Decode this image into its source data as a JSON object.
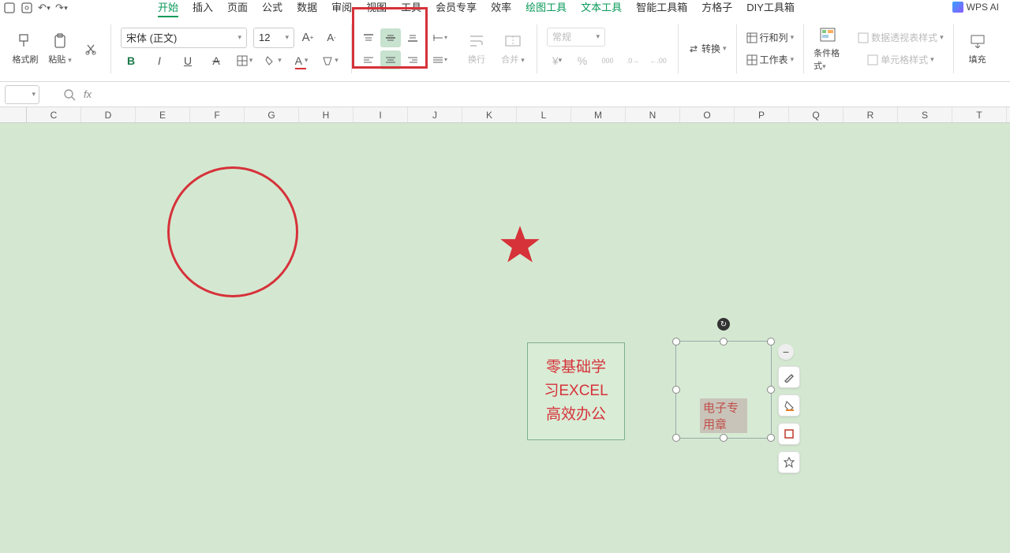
{
  "quick": {
    "undo": "↶",
    "redo": "↷"
  },
  "tabs": [
    "开始",
    "插入",
    "页面",
    "公式",
    "数据",
    "审阅",
    "视图",
    "工具",
    "会员专享",
    "效率",
    "绘图工具",
    "文本工具",
    "智能工具箱",
    "方格子",
    "DIY工具箱"
  ],
  "active_tab": "开始",
  "green_tabs": [
    "绘图工具",
    "文本工具"
  ],
  "wpsai": "WPS AI",
  "ribbon": {
    "format_painter": "格式刷",
    "paste": "粘贴",
    "font_name": "宋体 (正文)",
    "font_size": "12",
    "wrap": "换行",
    "merge": "合并",
    "num_format": "常规",
    "convert": "转换",
    "rowcol": "行和列",
    "sheet": "工作表",
    "cond_fmt": "条件格式",
    "pivot_style": "数据透视表样式",
    "cell_style": "单元格样式",
    "fill": "填充"
  },
  "columns": [
    "C",
    "D",
    "E",
    "F",
    "G",
    "H",
    "I",
    "J",
    "K",
    "L",
    "M",
    "N",
    "O",
    "P",
    "Q",
    "R",
    "S",
    "T"
  ],
  "shapes": {
    "textbox1_l1": "零基础学",
    "textbox1_l2": "习EXCEL",
    "textbox1_l3": "高效办公",
    "textbox2": "电子专用章"
  }
}
